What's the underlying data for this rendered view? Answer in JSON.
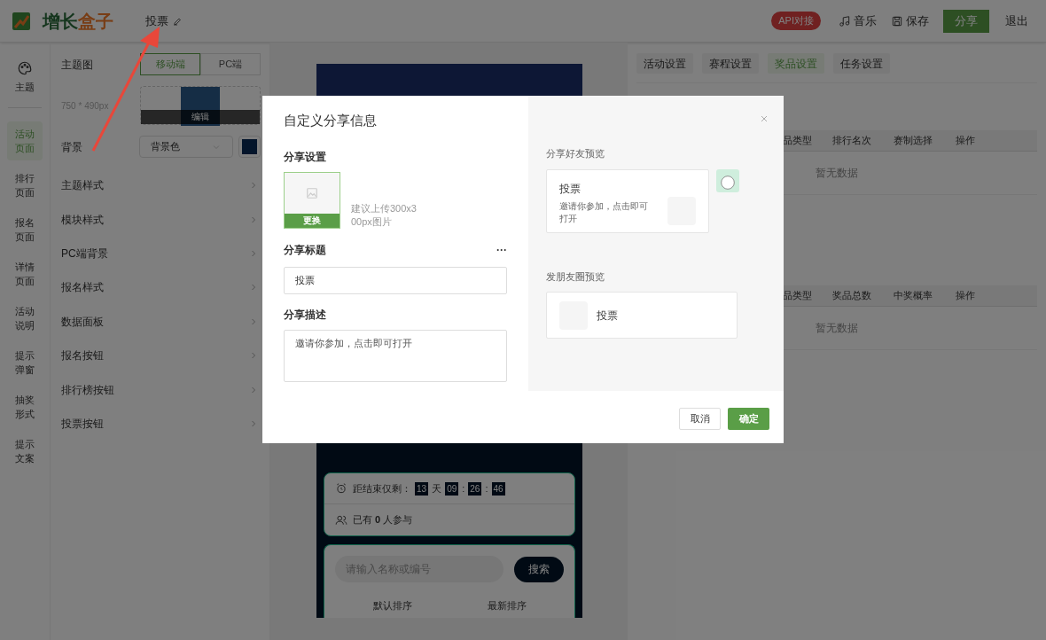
{
  "header": {
    "logo": {
      "part_1": "增长",
      "part_2": "盒子"
    },
    "title": "投票",
    "api_badge": "API对接",
    "actions": [
      {
        "kind": "music",
        "label": "音乐"
      },
      {
        "kind": "save",
        "label": "保存"
      }
    ],
    "share_button": "分享",
    "exit_link": "退出"
  },
  "rail": [
    {
      "kind": "icon",
      "label": "主题",
      "selected": false
    },
    {
      "kind": "text",
      "label": "活动页面",
      "selected": true
    },
    {
      "kind": "text",
      "label": "排行页面",
      "selected": false
    },
    {
      "kind": "text",
      "label": "报名页面",
      "selected": false
    },
    {
      "kind": "text",
      "label": "详情页面",
      "selected": false
    },
    {
      "kind": "text",
      "label": "活动说明",
      "selected": false
    },
    {
      "kind": "text",
      "label": "提示弹窗",
      "selected": false
    },
    {
      "kind": "text",
      "label": "抽奖形式",
      "selected": false
    },
    {
      "kind": "text",
      "label": "提示文案",
      "selected": false
    }
  ],
  "settings": {
    "theme_image": {
      "label": "主题图",
      "modes": [
        {
          "label": "移动端",
          "selected": true
        },
        {
          "label": "PC端",
          "selected": false
        }
      ],
      "size_hint": "750 * 490px",
      "edit": "编辑"
    },
    "background": {
      "label": "背景",
      "select": "背景色",
      "color": "#04152b"
    },
    "rows": [
      "主题样式",
      "模块样式",
      "PC端背景",
      "报名样式",
      "数据面板",
      "报名按钮",
      "排行榜按钮",
      "投票按钮"
    ]
  },
  "preview": {
    "countdown": {
      "label": "距结束仅剩：",
      "days": "13",
      "days_unit": "天",
      "hours": "09",
      "separator": ":",
      "minutes": "26",
      "seconds": "46"
    },
    "participants": "已有 **0** 人参与",
    "search": {
      "placeholder": "请输入名称或编号",
      "button": "搜索"
    },
    "sort": [
      "默认排序",
      "最新排序"
    ]
  },
  "right_panel": {
    "tabs": [
      {
        "label": "活动设置",
        "selected": false
      },
      {
        "label": "赛程设置",
        "selected": false
      },
      {
        "label": "奖品设置",
        "selected": true
      },
      {
        "label": "任务设置",
        "selected": false
      }
    ],
    "tables": [
      {
        "columns": [
          "品类型",
          "排行名次",
          "赛制选择",
          "操作"
        ],
        "empty": "暂无数据"
      },
      {
        "columns": [
          "品类型",
          "奖品总数",
          "中奖概率",
          "操作"
        ],
        "empty": "暂无数据"
      }
    ]
  },
  "modal": {
    "title": "自定义分享信息",
    "share_settings": {
      "label": "分享设置",
      "replace": "更换",
      "hint": "建议上传300x300px图片"
    },
    "share_title": {
      "label": "分享标题",
      "more": "···",
      "value": "投票"
    },
    "share_desc": {
      "label": "分享描述",
      "value": "邀请你参加，点击即可打开"
    },
    "friend_preview": {
      "label": "分享好友预览",
      "title": "投票",
      "desc": "邀请你参加，点击即可打开"
    },
    "moments_preview": {
      "label": "发朋友圈预览",
      "title": "投票"
    },
    "buttons": [
      {
        "kind": "cancel",
        "label": "取消"
      },
      {
        "kind": "confirm",
        "label": "确定"
      }
    ]
  }
}
